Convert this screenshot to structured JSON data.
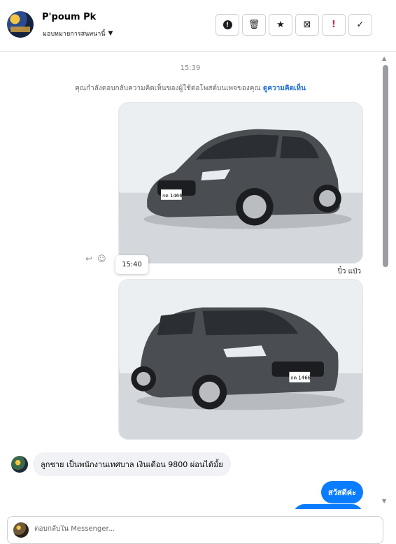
{
  "header": {
    "page_name": "P'poum Pk",
    "assign_label": "มอบหมายการสนทนานี้",
    "toolbar": [
      {
        "name": "report-button",
        "icon": "!"
      },
      {
        "name": "delete-button",
        "icon": "🗑"
      },
      {
        "name": "star-button",
        "icon": "★"
      },
      {
        "name": "archive-button",
        "icon": "⊠"
      },
      {
        "name": "spam-button",
        "icon": "!"
      },
      {
        "name": "done-button",
        "icon": "✓"
      }
    ]
  },
  "thread": {
    "timestamp_1": "15:39",
    "context_text": "คุณกำลังตอบกลับความคิดเห็นของผู้ใช้ต่อโพสต์บนเพจของคุณ",
    "context_link": "ดูความคิดเห็น",
    "tooltip_time": "15:40",
    "sender_label": "ปิ๋ว แป๋ว",
    "incoming_message": "ลูกชาย เป็นพนักงานเทศบาล เงินเดือน 9800 ผ่อนได้มั้ย",
    "outgoing_message": "สวัสดีค่ะ",
    "plate_text": "กค 1466"
  },
  "composer": {
    "placeholder": "ตอบกลับใน Messenger..."
  },
  "colors": {
    "accent": "#0a7cff",
    "link": "#216fdb",
    "car_body": "#4a4d52"
  }
}
